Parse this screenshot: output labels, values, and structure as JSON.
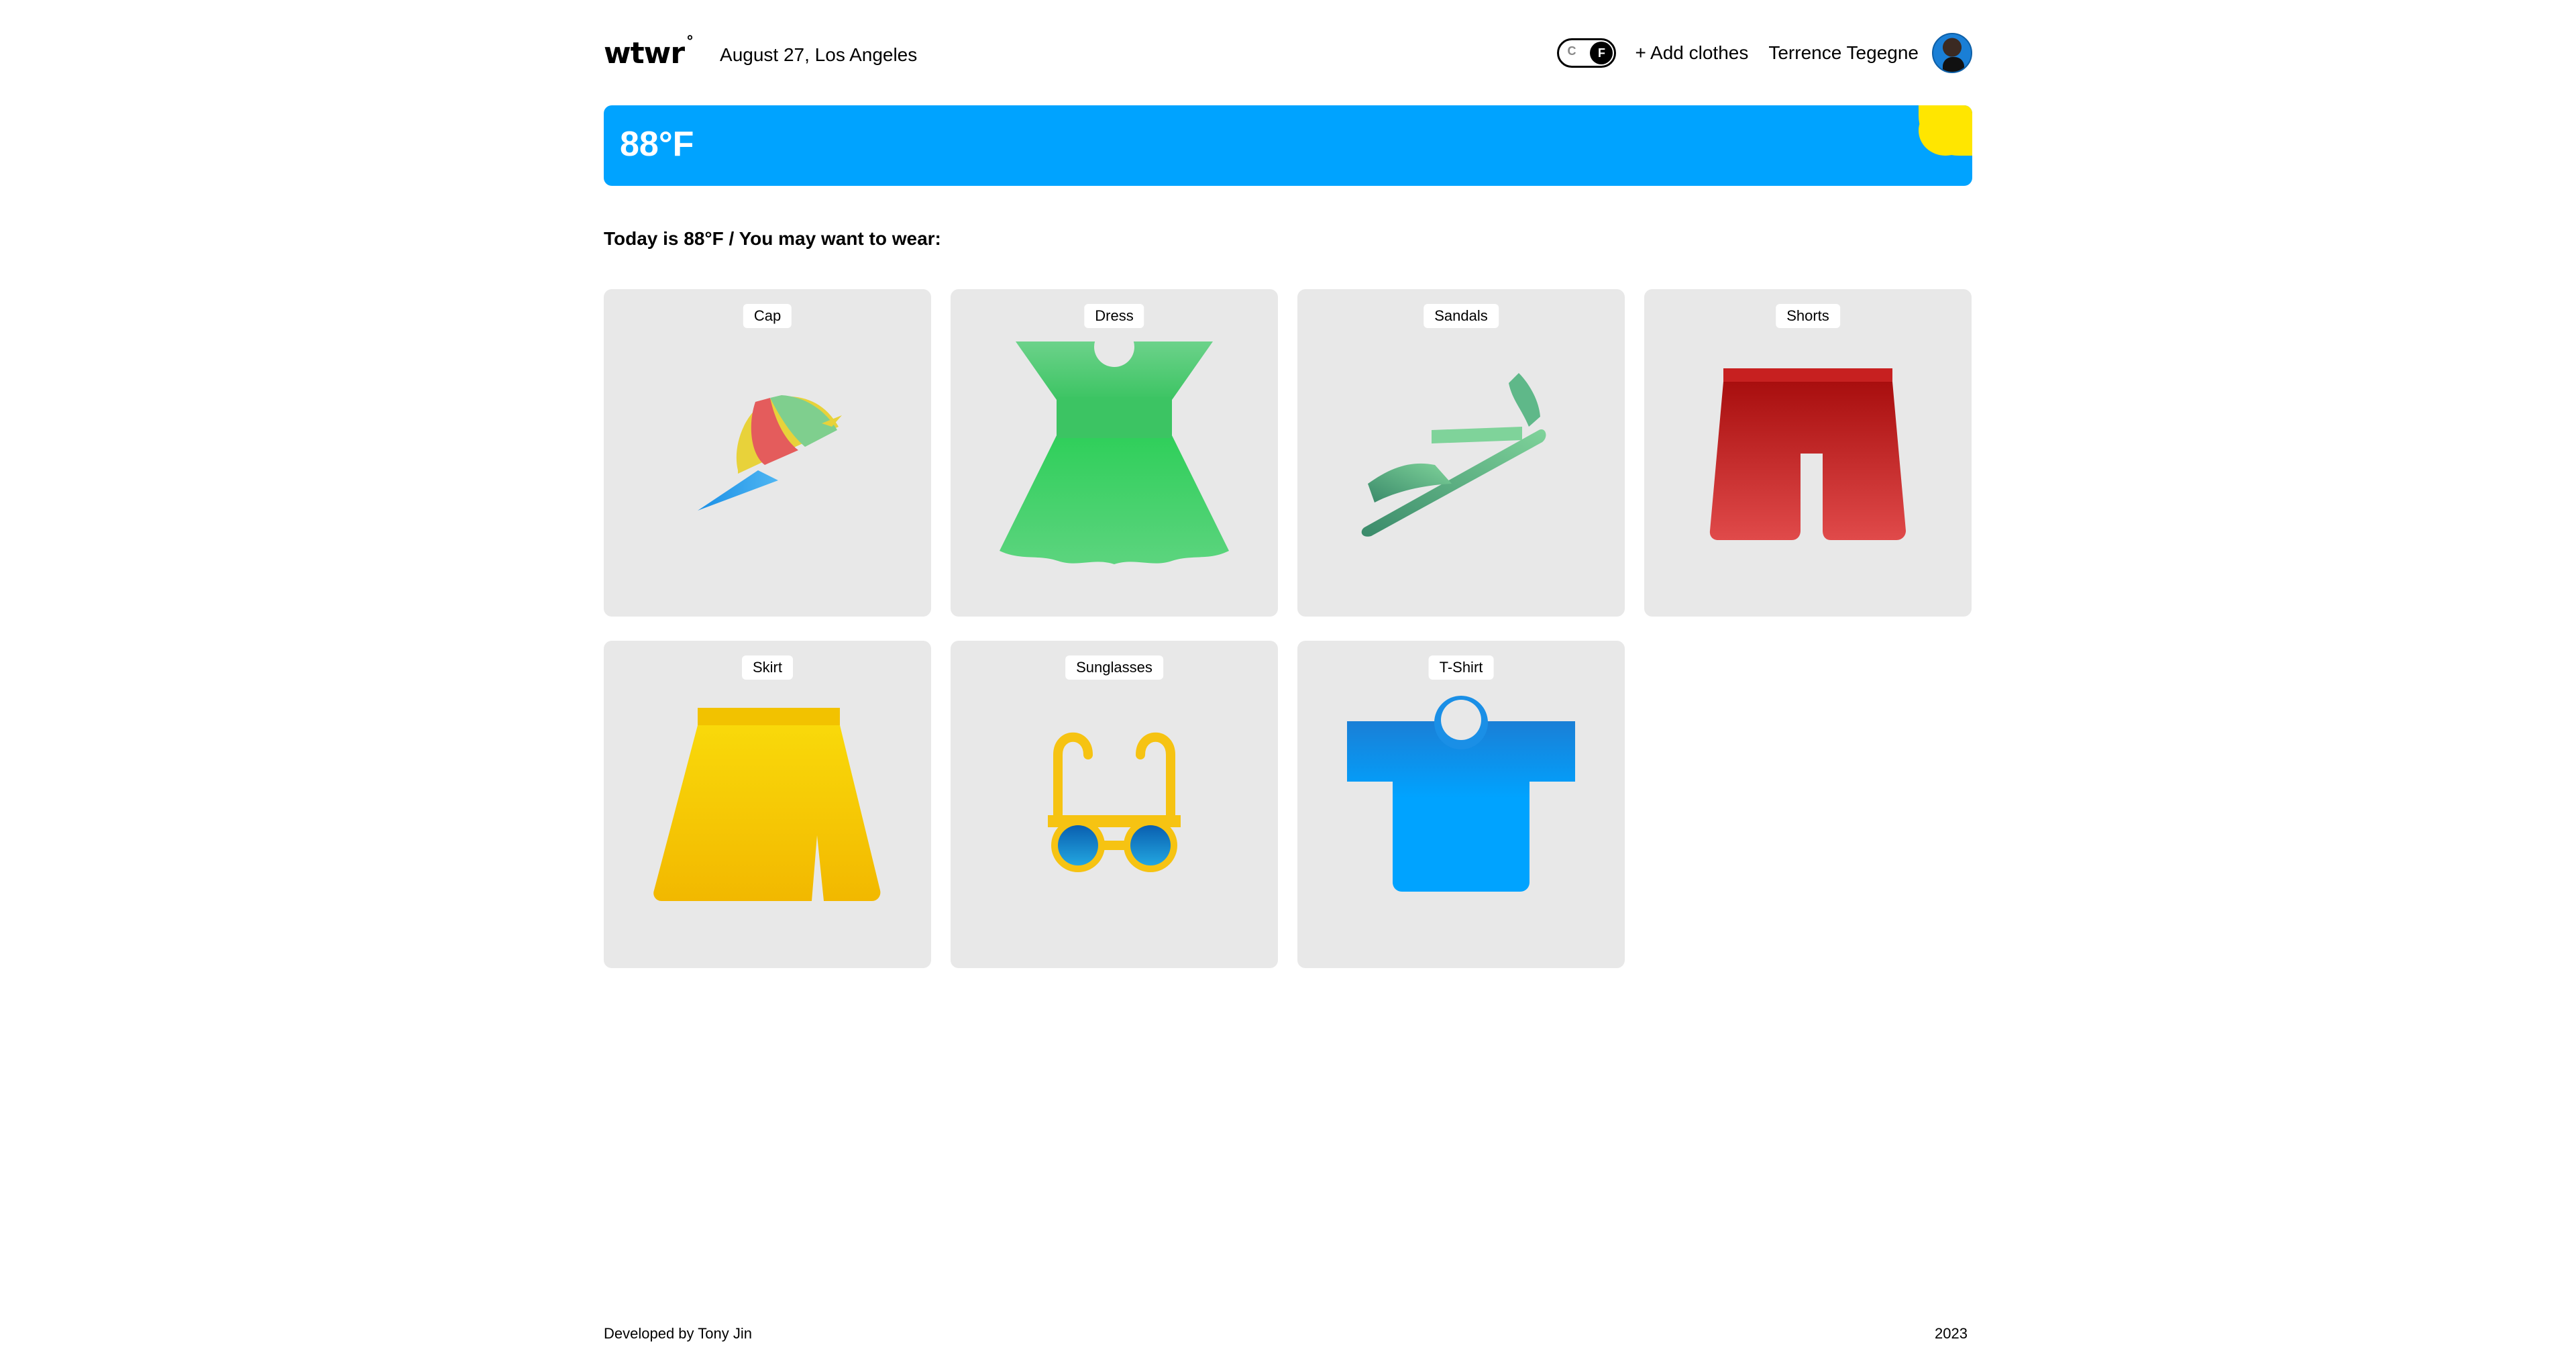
{
  "header": {
    "logo": "wtwr",
    "logo_mark": "°",
    "date_location": "August 27, Los Angeles",
    "toggle": {
      "option_c": "C",
      "option_f": "F",
      "selected": "F"
    },
    "add_clothes": "+ Add clothes",
    "username": "Terrence Tegegne"
  },
  "weather": {
    "temperature": "88°F"
  },
  "recommendation": "Today is 88°F / You may want to wear:",
  "cards": [
    {
      "label": "Cap",
      "icon": "cap-icon"
    },
    {
      "label": "Dress",
      "icon": "dress-icon"
    },
    {
      "label": "Sandals",
      "icon": "sandals-icon"
    },
    {
      "label": "Shorts",
      "icon": "shorts-icon"
    },
    {
      "label": "Skirt",
      "icon": "skirt-icon"
    },
    {
      "label": "Sunglasses",
      "icon": "sunglasses-icon"
    },
    {
      "label": "T-Shirt",
      "icon": "tshirt-icon"
    }
  ],
  "footer": {
    "credit": "Developed by Tony Jin",
    "year": "2023"
  },
  "colors": {
    "banner": "#00a3ff",
    "sun": "#ffe600",
    "card_bg": "#e8e8e8"
  }
}
